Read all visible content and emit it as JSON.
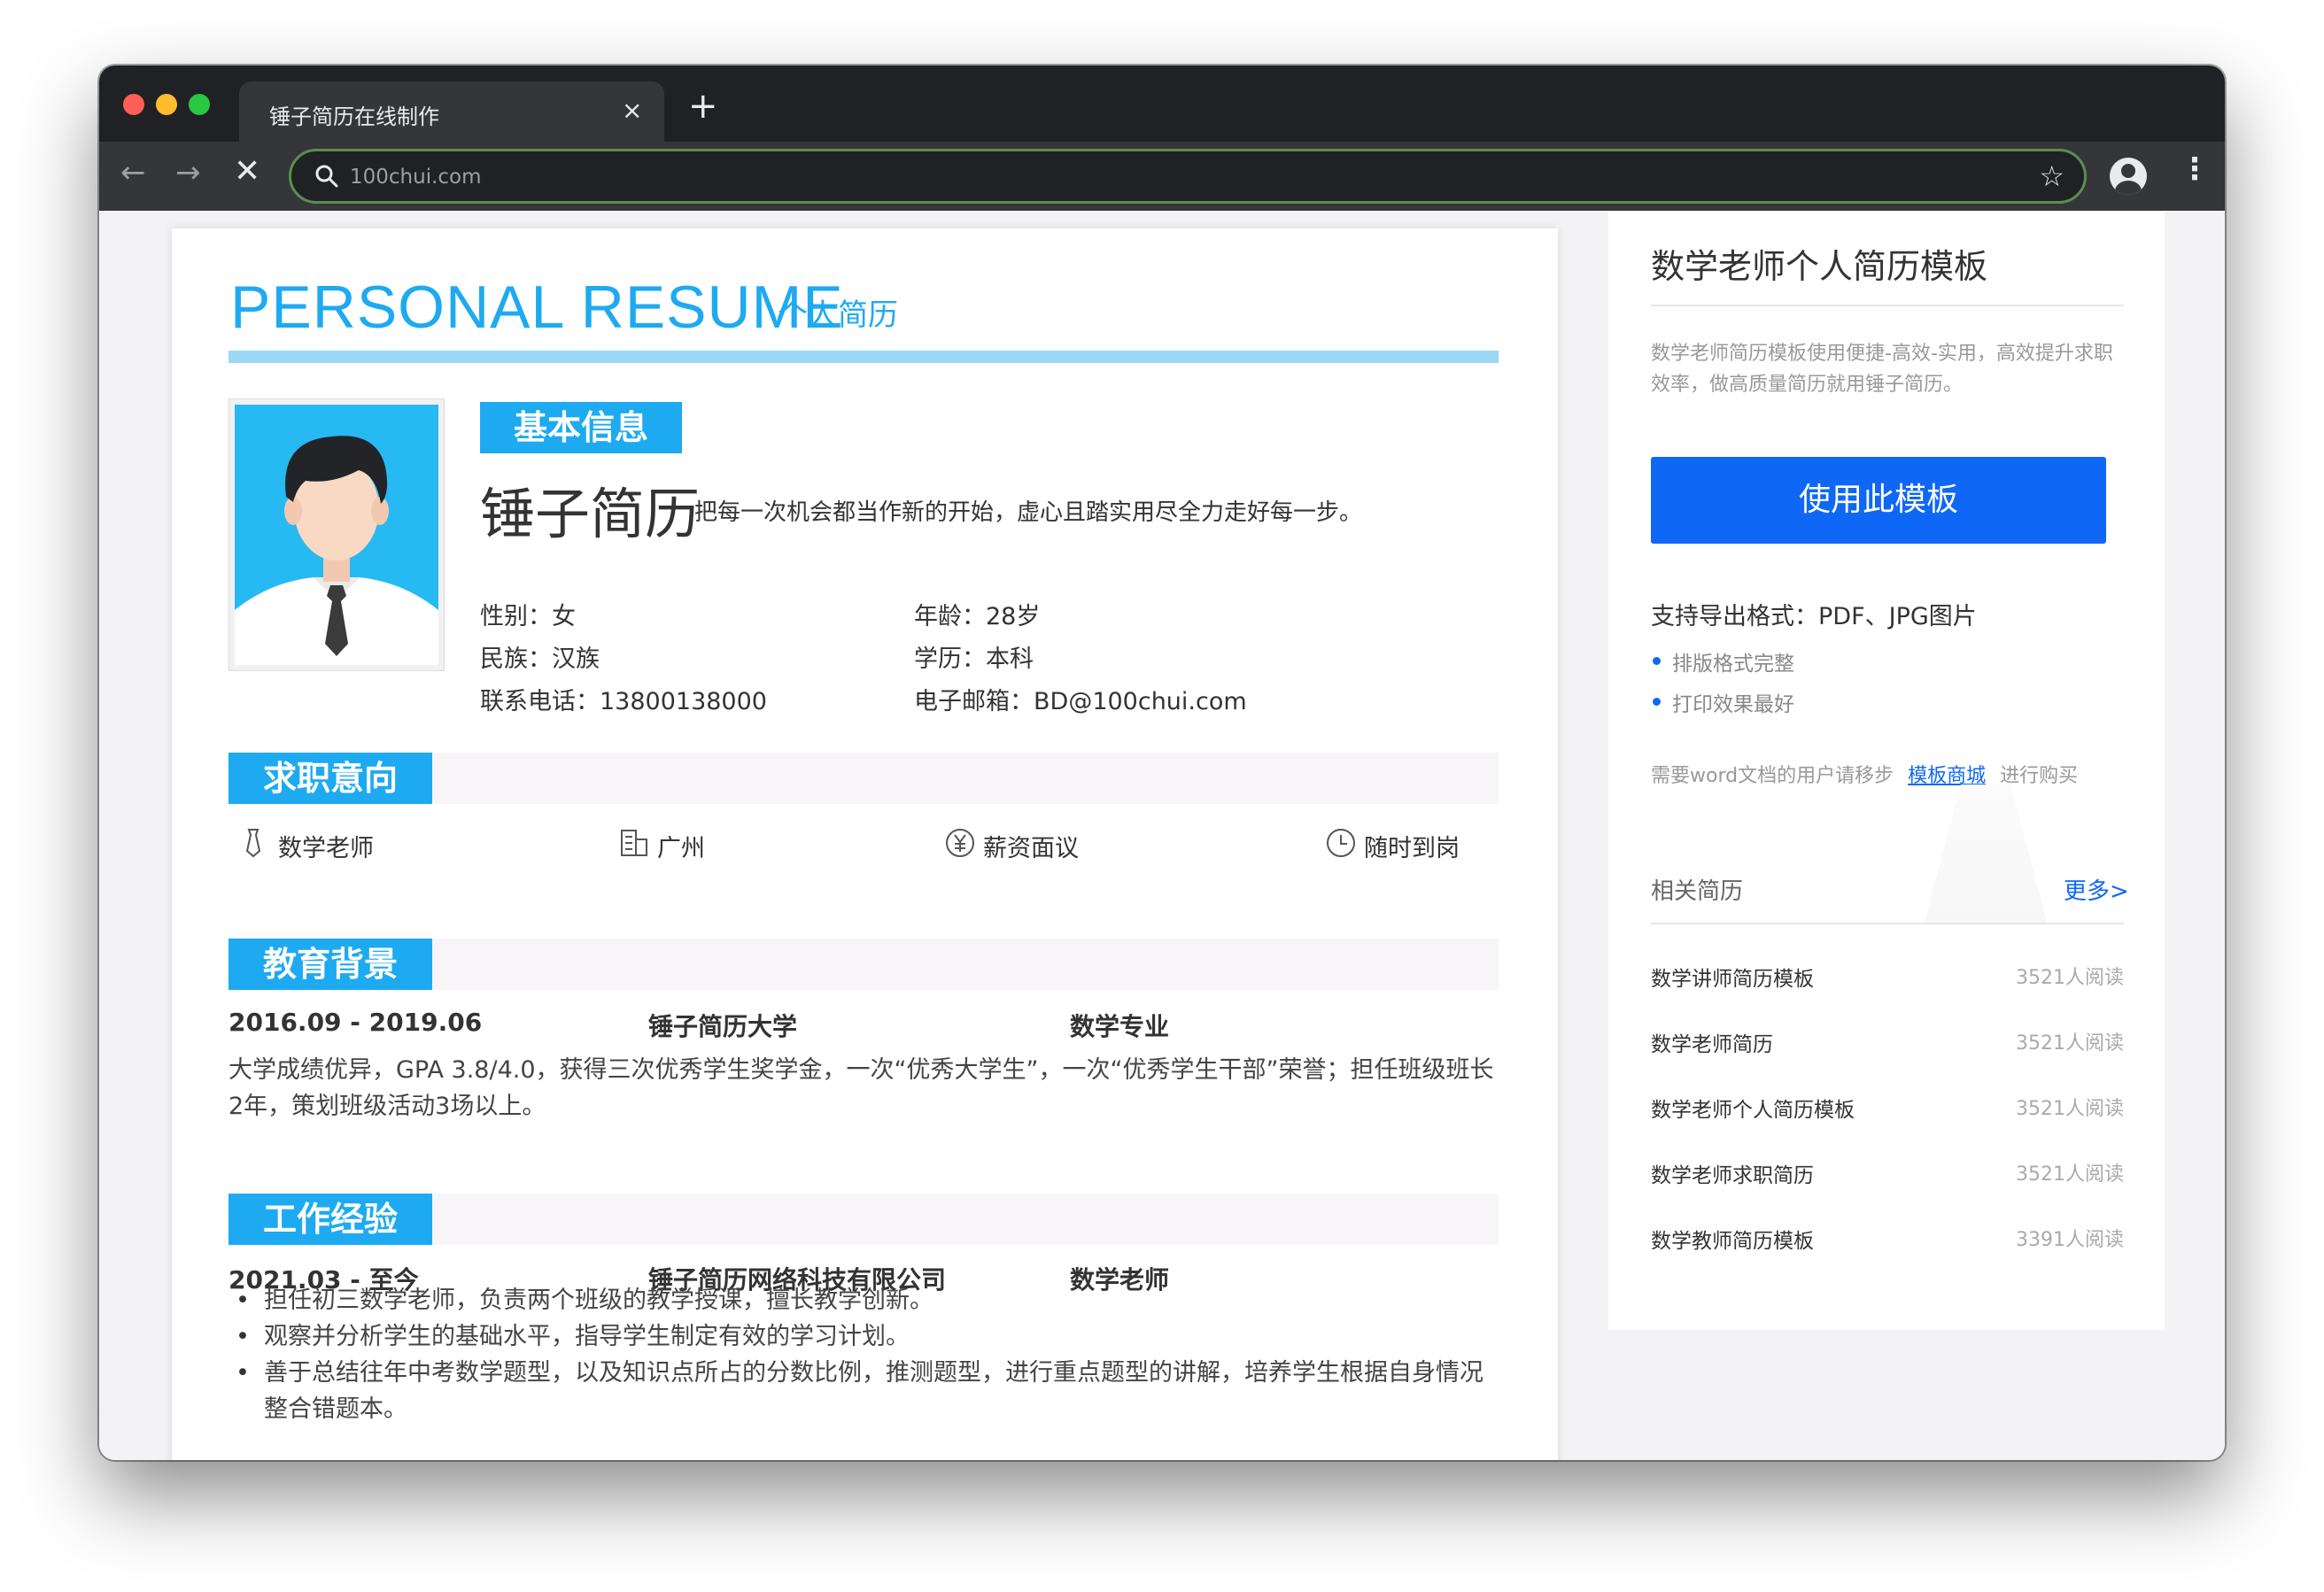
{
  "browser": {
    "tab_title": "锤子简历在线制作",
    "tab_close": "×",
    "new_tab": "+",
    "url": "100chui.com",
    "back_icon": "arrow-left-icon",
    "forward_icon": "arrow-right-icon",
    "stop_icon": "close-icon",
    "star_icon": "star-icon",
    "colors": {
      "frame": "#202124",
      "toolbar": "#35363a",
      "omnibox_border": "#5a8f4e"
    }
  },
  "resume": {
    "title_en": "PERSONAL RESUME",
    "title_cn": "个人简历",
    "basic": {
      "tag": "基本信息",
      "name": "锤子简历",
      "motto": "把每一次机会都当作新的开始，虚心且踏实用尽全力走好每一步。",
      "gender": "性别：女",
      "age": "年龄：28岁",
      "ethnicity": "民族：汉族",
      "education": "学历：本科",
      "phone": "联系电话：13800138000",
      "email": "电子邮箱：BD@100chui.com"
    },
    "intent": {
      "tag": "求职意向",
      "position": "数学老师",
      "city": "广州",
      "salary": "薪资面议",
      "availability": "随时到岗"
    },
    "edu": {
      "tag": "教育背景",
      "period": "2016.09 - 2019.06",
      "school": "锤子简历大学",
      "major": "数学专业",
      "desc": "大学成绩优异，GPA 3.8/4.0，获得三次优秀学生奖学金，一次“优秀大学生”，一次“优秀学生干部”荣誉；担任班级班长2年，策划班级活动3场以上。"
    },
    "work": {
      "tag": "工作经验",
      "period": "2021.03 - 至今",
      "company": "锤子简历网络科技有限公司",
      "role": "数学老师",
      "bullets": [
        "担任初三数学老师，负责两个班级的教学授课，擅长教学创新。",
        "观察并分析学生的基础水平，指导学生制定有效的学习计划。",
        "善于总结往年中考数学题型，以及知识点所占的分数比例，推测题型，进行重点题型的讲解，培养学生根据自身情况整合错题本。"
      ]
    },
    "accent_color": "#1eaaf1"
  },
  "sidebar": {
    "title": "数学老师个人简历模板",
    "desc": "数学老师简历模板使用便捷-高效-实用，高效提升求职效率，做高质量简历就用锤子简历。",
    "use_button": "使用此模板",
    "export": "支持导出格式：PDF、JPG图片",
    "features": [
      "排版格式完整",
      "打印效果最好"
    ],
    "word_prefix": "需要word文档的用户请移步",
    "word_link": "模板商城",
    "word_suffix": "进行购买",
    "related_label": "相关简历",
    "more_label": "更多>",
    "related": [
      {
        "name": "数学讲师简历模板",
        "count": "3521人阅读"
      },
      {
        "name": "数学老师简历",
        "count": "3521人阅读"
      },
      {
        "name": "数学老师个人简历模板",
        "count": "3521人阅读"
      },
      {
        "name": "数学老师求职简历",
        "count": "3521人阅读"
      },
      {
        "name": "数学教师简历模板",
        "count": "3391人阅读"
      }
    ],
    "button_color": "#0f68f5"
  }
}
